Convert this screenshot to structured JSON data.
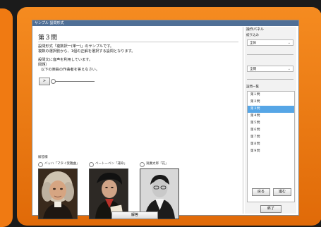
{
  "window": {
    "title": "サンプル 設問形式"
  },
  "question": {
    "title": "第３問",
    "desc_line1": "設問形式「複数択一(単一)」のサンプルです。",
    "desc_line2": "複数の選択肢から、1個の正解を選択する設問となります。",
    "sub_line1": "設問文に音声を利用しています。",
    "sub_line2": "問題）",
    "sub_line3": "以下の楽曲の作曲者を答えなさい。"
  },
  "player": {
    "play_label": ">"
  },
  "answers": {
    "label": "解答欄",
    "choices": [
      {
        "label": "バッハ「マタイ受難曲」",
        "portrait": "bach-portrait"
      },
      {
        "label": "ベートーベン「運命」",
        "portrait": "beethoven-portrait"
      },
      {
        "label": "滝廉太郎「花」",
        "portrait": "taki-portrait"
      }
    ]
  },
  "submit_label": "解答",
  "side": {
    "title": "操作パネル",
    "filter_label": "絞り込み",
    "filter_value": "全体",
    "filter2_value": "全問",
    "list_label": "設問一覧",
    "questions": [
      "第１問",
      "第２問",
      "第３問",
      "第４問",
      "第５問",
      "第６問",
      "第７問",
      "第８問",
      "第９問"
    ],
    "selected_index": 2,
    "prev_label": "戻る",
    "next_label": "進む",
    "finish_label": "終了"
  },
  "colors": {
    "accent": "#56a6e6",
    "background": "#f07a12",
    "titlebar": "#4f6f96"
  }
}
